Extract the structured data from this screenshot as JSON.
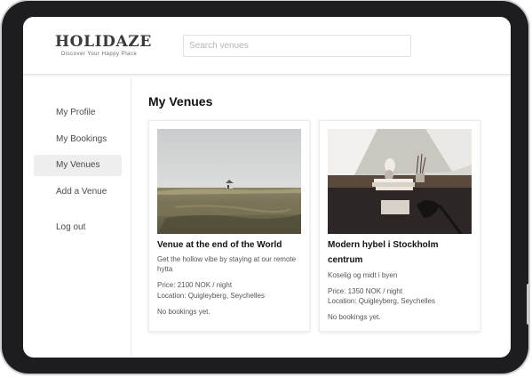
{
  "header": {
    "logo": "HOLIDAZE",
    "tagline": "Discover Your Happy Place",
    "search_placeholder": "Search venues"
  },
  "sidebar": {
    "items": [
      {
        "label": "My Profile",
        "active": false
      },
      {
        "label": "My Bookings",
        "active": false
      },
      {
        "label": "My Venues",
        "active": true
      },
      {
        "label": "Add a Venue",
        "active": false
      },
      {
        "label": "Log out",
        "active": false
      }
    ]
  },
  "main": {
    "title": "My Venues",
    "venues": [
      {
        "name": "Venue at the end of the World",
        "description": "Get the hollow vibe by staying at our remote hytta",
        "price": "Price: 2100 NOK / night",
        "location": "Location: Quigleyberg, Seychelles",
        "bookings": "No bookings yet.",
        "image": "landscape-cabin-photo"
      },
      {
        "name": "Modern hybel i Stockholm centrum",
        "description": "Koselig og midt i byen",
        "price": "Price: 1350 NOK / night",
        "location": "Location: Quigleyberg, Seychelles",
        "bookings": "No bookings yet.",
        "image": "interior-shelf-photo"
      }
    ]
  },
  "colors": {
    "device_frame": "#1d1d1f",
    "active_item_bg": "#eeeeee",
    "text_primary": "#111111",
    "text_secondary": "#555555"
  }
}
